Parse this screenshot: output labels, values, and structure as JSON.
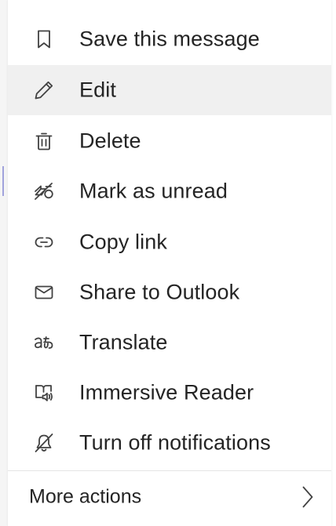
{
  "context_menu": {
    "items": [
      {
        "label": "Save this message",
        "icon": "bookmark-icon"
      },
      {
        "label": "Edit",
        "icon": "pencil-icon",
        "state": "hovered"
      },
      {
        "label": "Delete",
        "icon": "trash-icon"
      },
      {
        "label": "Mark as unread",
        "icon": "mark-unread-icon"
      },
      {
        "label": "Copy link",
        "icon": "link-icon"
      },
      {
        "label": "Share to Outlook",
        "icon": "mail-icon"
      },
      {
        "label": "Translate",
        "icon": "translate-icon"
      },
      {
        "label": "Immersive Reader",
        "icon": "immersive-reader-icon"
      },
      {
        "label": "Turn off notifications",
        "icon": "bell-off-icon"
      }
    ],
    "more_actions": {
      "label": "More actions",
      "icon": "chevron-right-icon"
    }
  },
  "colors": {
    "text": "#242424",
    "icon": "#424242",
    "hover_background": "#f0f0f0",
    "divider": "#e4e4e4",
    "accent": "#5b5fc7"
  }
}
